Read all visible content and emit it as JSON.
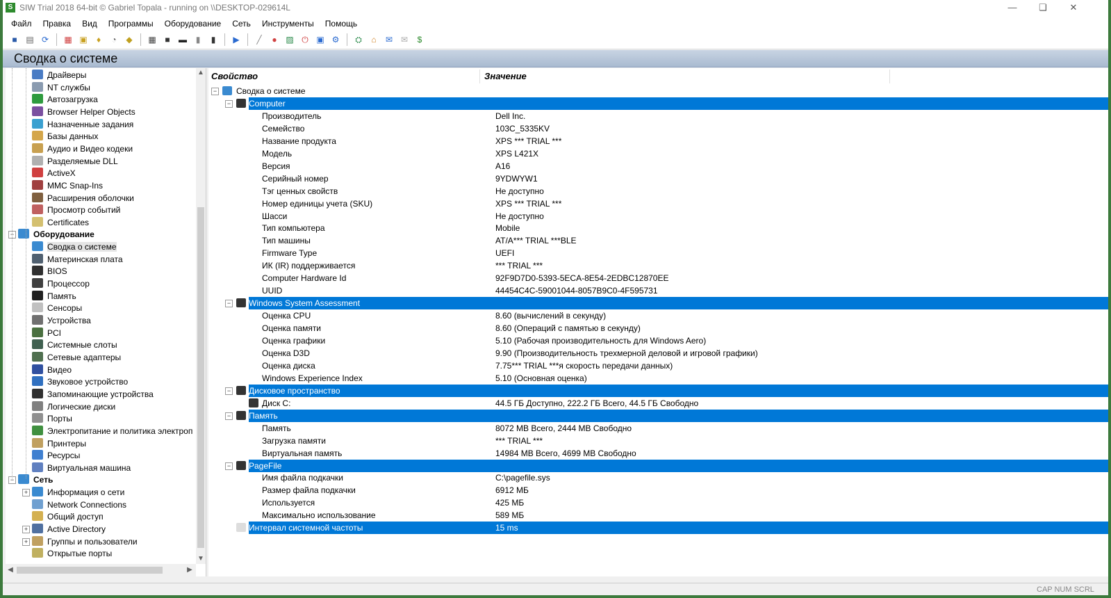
{
  "window": {
    "title": "SIW Trial 2018 64-bit  © Gabriel Topala - running on \\\\DESKTOP-029614L",
    "controls": [
      "minimize-icon",
      "restore-icon",
      "close-icon"
    ]
  },
  "menu": [
    "Файл",
    "Правка",
    "Вид",
    "Программы",
    "Оборудование",
    "Сеть",
    "Инструменты",
    "Помощь"
  ],
  "toolbar_icons": [
    "save-icon",
    "print-icon",
    "refresh-icon",
    "|",
    "apps-icon",
    "lock-icon",
    "key-icon",
    "clock-icon",
    "shield-icon",
    "|",
    "cpu-icon",
    "chip-icon",
    "memory-icon",
    "battery-icon",
    "disk-icon",
    "|",
    "network-icon",
    "|",
    "monitor-icon",
    "globe-icon",
    "screen-icon",
    "power-icon",
    "display-icon",
    "gear-icon",
    "|",
    "network-map-icon",
    "home-icon",
    "message-icon",
    "mail-icon",
    "dollar-icon"
  ],
  "header": {
    "title": "Сводка о системе"
  },
  "tree": [
    {
      "label": "Драйверы",
      "icon": "drivers-icon",
      "color": "#4a7cc4"
    },
    {
      "label": "NT службы",
      "icon": "services-icon",
      "color": "#8a9bb0"
    },
    {
      "label": "Автозагрузка",
      "icon": "startup-icon",
      "color": "#2e9b3e"
    },
    {
      "label": "Browser Helper Objects",
      "icon": "bho-icon",
      "color": "#7a4fa0"
    },
    {
      "label": "Назначенные задания",
      "icon": "tasks-icon",
      "color": "#3aa0d0"
    },
    {
      "label": "Базы данных",
      "icon": "database-icon",
      "color": "#d4a64a"
    },
    {
      "label": "Аудио и Видео кодеки",
      "icon": "codecs-icon",
      "color": "#c8a050"
    },
    {
      "label": "Разделяемые DLL",
      "icon": "dll-icon",
      "color": "#b0b0b0"
    },
    {
      "label": "ActiveX",
      "icon": "activex-icon",
      "color": "#d04040"
    },
    {
      "label": "MMC Snap-Ins",
      "icon": "mmc-icon",
      "color": "#a04040"
    },
    {
      "label": "Расширения оболочки",
      "icon": "shell-icon",
      "color": "#806040"
    },
    {
      "label": "Просмотр событий",
      "icon": "events-icon",
      "color": "#c06060"
    },
    {
      "label": "Certificates",
      "icon": "cert-icon",
      "color": "#d4c070"
    },
    {
      "label": "Оборудование",
      "icon": "hardware-icon",
      "color": "#3a8ad0",
      "bold": true,
      "group": true
    },
    {
      "label": "Сводка о системе",
      "icon": "summary-icon",
      "color": "#3a8ad0",
      "selected": true
    },
    {
      "label": "Материнская плата",
      "icon": "motherboard-icon",
      "color": "#506070"
    },
    {
      "label": "BIOS",
      "icon": "bios-icon",
      "color": "#303030"
    },
    {
      "label": "Процессор",
      "icon": "cpu-icon",
      "color": "#404040"
    },
    {
      "label": "Память",
      "icon": "memory-icon",
      "color": "#202020"
    },
    {
      "label": "Сенсоры",
      "icon": "sensors-icon",
      "color": "#c0c0c0"
    },
    {
      "label": "Устройства",
      "icon": "devices-icon",
      "color": "#707070"
    },
    {
      "label": "PCI",
      "icon": "pci-icon",
      "color": "#4a7040"
    },
    {
      "label": "Системные слоты",
      "icon": "slots-icon",
      "color": "#406050"
    },
    {
      "label": "Сетевые адаптеры",
      "icon": "adapters-icon",
      "color": "#507050"
    },
    {
      "label": "Видео",
      "icon": "video-icon",
      "color": "#3050a0"
    },
    {
      "label": "Звуковое устройство",
      "icon": "sound-icon",
      "color": "#3070c0"
    },
    {
      "label": "Запоминающие устройства",
      "icon": "storage-icon",
      "color": "#303030"
    },
    {
      "label": "Логические диски",
      "icon": "drives-icon",
      "color": "#808080"
    },
    {
      "label": "Порты",
      "icon": "ports-icon",
      "color": "#909090"
    },
    {
      "label": "Электропитание и политика электроп",
      "icon": "power-icon",
      "color": "#409040"
    },
    {
      "label": "Принтеры",
      "icon": "printers-icon",
      "color": "#c0a060"
    },
    {
      "label": "Ресурсы",
      "icon": "resources-icon",
      "color": "#4080d0"
    },
    {
      "label": "Виртуальная машина",
      "icon": "vm-icon",
      "color": "#6080c0"
    },
    {
      "label": "Сеть",
      "icon": "network-icon",
      "color": "#3a8ad0",
      "bold": true,
      "group": true
    },
    {
      "label": "Информация о сети",
      "icon": "netinfo-icon",
      "color": "#3a8ad0",
      "expandable": true
    },
    {
      "label": "Network Connections",
      "icon": "netconn-icon",
      "color": "#70a0d0"
    },
    {
      "label": "Общий доступ",
      "icon": "shares-icon",
      "color": "#d4b050"
    },
    {
      "label": "Active Directory",
      "icon": "ad-icon",
      "color": "#5070a0",
      "expandable": true
    },
    {
      "label": "Группы и пользователи",
      "icon": "users-icon",
      "color": "#c0a060",
      "expandable": true
    },
    {
      "label": "Открытые порты",
      "icon": "openports-icon",
      "color": "#c0b060"
    }
  ],
  "columns": {
    "property": "Свойство",
    "value": "Значение"
  },
  "rows": [
    {
      "prop": "Сводка о системе",
      "val": "",
      "kind": "root"
    },
    {
      "prop": "Computer",
      "val": "",
      "kind": "section",
      "icon": "computer-icon"
    },
    {
      "prop": "Производитель",
      "val": "Dell Inc."
    },
    {
      "prop": "Семейство",
      "val": "103C_5335KV"
    },
    {
      "prop": "Название продукта",
      "val": "XPS *** TRIAL ***"
    },
    {
      "prop": "Модель",
      "val": "XPS L421X"
    },
    {
      "prop": "Версия",
      "val": "A16"
    },
    {
      "prop": "Серийный номер",
      "val": "9YDWYW1"
    },
    {
      "prop": "Тэг ценных свойств",
      "val": "Не доступно"
    },
    {
      "prop": "Номер единицы учета (SKU)",
      "val": "XPS *** TRIAL ***"
    },
    {
      "prop": "Шасси",
      "val": "Не доступно"
    },
    {
      "prop": "Тип компьютера",
      "val": "Mobile"
    },
    {
      "prop": "Тип машины",
      "val": "AT/A*** TRIAL ***BLE"
    },
    {
      "prop": "Firmware Type",
      "val": "UEFI"
    },
    {
      "prop": "ИК (IR) поддерживается",
      "val": "*** TRIAL ***"
    },
    {
      "prop": "Computer Hardware Id",
      "val": "92F9D7D0-5393-5ECA-8E54-2EDBC12870EE"
    },
    {
      "prop": "UUID",
      "val": "44454C4C-59001044-8057B9C0-4F595731"
    },
    {
      "prop": "Windows System Assessment",
      "val": "",
      "kind": "section",
      "icon": "assessment-icon"
    },
    {
      "prop": "Оценка CPU",
      "val": "8.60 (вычислений в секунду)"
    },
    {
      "prop": "Оценка памяти",
      "val": "8.60 (Операций с памятью в секунду)"
    },
    {
      "prop": "Оценка графики",
      "val": "5.10 (Рабочая производительность для Windows Aero)"
    },
    {
      "prop": "Оценка D3D",
      "val": "9.90 (Производительность трехмерной деловой и игровой графики)"
    },
    {
      "prop": "Оценка диска",
      "val": "7.75*** TRIAL ***я скорость передачи данных)"
    },
    {
      "prop": "Windows Experience Index",
      "val": "5.10 (Основная оценка)"
    },
    {
      "prop": "Дисковое пространство",
      "val": "",
      "kind": "section",
      "icon": "disk-icon"
    },
    {
      "prop": "Диск C:",
      "val": "44.5 ГБ Доступно, 222.2 ГБ Всего, 44.5 ГБ Свободно",
      "icon": "drive-icon"
    },
    {
      "prop": "Память",
      "val": "",
      "kind": "section",
      "icon": "memory-icon"
    },
    {
      "prop": "Память",
      "val": "8072 MB Всего, 2444 MB Свободно"
    },
    {
      "prop": "Загрузка памяти",
      "val": "*** TRIAL ***"
    },
    {
      "prop": "Виртуальная память",
      "val": "14984 MB Всего, 4699 MB Свободно"
    },
    {
      "prop": "PageFile",
      "val": "",
      "kind": "section"
    },
    {
      "prop": "Имя файла подкачки",
      "val": "C:\\pagefile.sys"
    },
    {
      "prop": "Размер файла подкачки",
      "val": "6912 МБ"
    },
    {
      "prop": "Используется",
      "val": "425 МБ"
    },
    {
      "prop": "Максимально использование",
      "val": "589 МБ"
    },
    {
      "prop": "Интервал системной частоты",
      "val": "15 ms",
      "kind": "section-last",
      "icon": "timer-icon"
    }
  ],
  "statusbar": {
    "indicators": "CAP  NUM  SCRL"
  },
  "colors": {
    "selection": "#0078d7",
    "header_bg": "#b6c6da",
    "desktop": "#3c7a3c"
  }
}
